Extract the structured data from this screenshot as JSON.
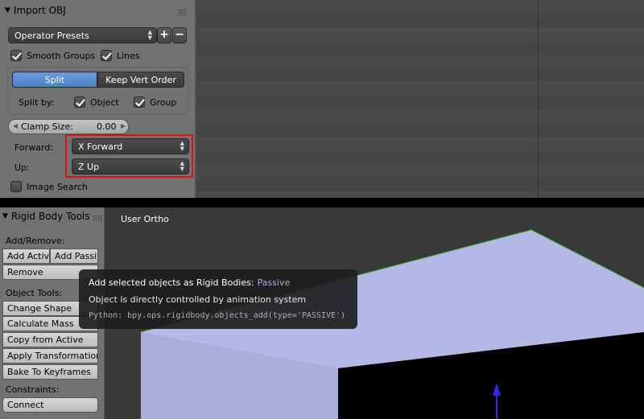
{
  "import_panel": {
    "title": "Import OBJ",
    "presets_label": "Operator Presets",
    "add_preset": "+",
    "remove_preset": "−",
    "smooth_groups": "Smooth Groups",
    "lines": "Lines",
    "split_label": "Split",
    "keep_vert_order_label": "Keep Vert Order",
    "split_by_label": "Split by:",
    "object_label": "Object",
    "group_label": "Group",
    "clamp_size_label": "Clamp Size:",
    "clamp_size_value": "0.00",
    "forward_label": "Forward:",
    "forward_value": "X Forward",
    "up_label": "Up:",
    "up_value": "Z Up",
    "image_search": "Image Search"
  },
  "rigid_body_panel": {
    "title": "Rigid Body Tools",
    "add_remove_header": "Add/Remove:",
    "add_active": "Add Activ",
    "add_passive": "Add Passiv",
    "remove": "Remove",
    "object_tools_header": "Object Tools:",
    "change_shape": "Change Shape",
    "calculate_mass": "Calculate Mass",
    "copy_from_active": "Copy from Active",
    "apply_transformation": "Apply Transformation",
    "bake_to_keyframes": "Bake To Keyframes",
    "constraints_header": "Constraints:",
    "connect": "Connect"
  },
  "viewport": {
    "view_label": "User Ortho"
  },
  "tooltip": {
    "title": "Add selected objects as Rigid Bodies:",
    "highlight": "Passive",
    "description": "Object is directly controlled by animation system",
    "python": "Python: bpy.ops.rigidbody.objects_add(type='PASSIVE')"
  },
  "colors": {
    "highlight_red": "#e01010",
    "selected_blue": "#5f8fd6",
    "plane_fill": "#b4b8e6",
    "edge_green": "#4fbf4f",
    "axis_blue": "#2a2aee"
  }
}
